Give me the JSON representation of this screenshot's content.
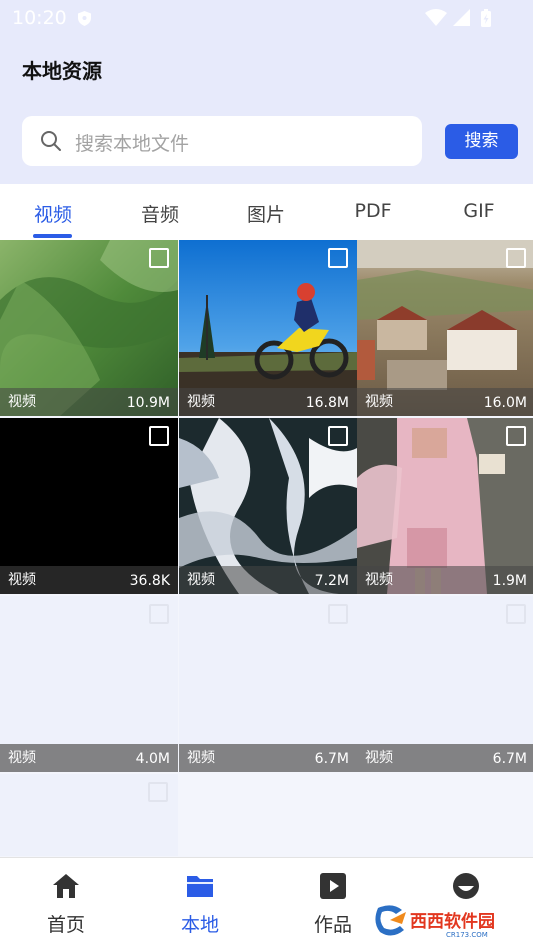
{
  "status_bar": {
    "time": "10:20"
  },
  "header": {
    "title": "本地资源"
  },
  "search": {
    "placeholder": "搜索本地文件",
    "button_label": "搜索"
  },
  "tabs": [
    {
      "label": "视频",
      "active": true
    },
    {
      "label": "音频",
      "active": false
    },
    {
      "label": "图片",
      "active": false
    },
    {
      "label": "PDF",
      "active": false
    },
    {
      "label": "GIF",
      "active": false
    }
  ],
  "media_items": [
    {
      "type_label": "视频",
      "size": "10.9M",
      "thumbnail": "green-mountain-aerial"
    },
    {
      "type_label": "视频",
      "size": "16.8M",
      "thumbnail": "motocross-rider"
    },
    {
      "type_label": "视频",
      "size": "16.0M",
      "thumbnail": "town-aerial"
    },
    {
      "type_label": "视频",
      "size": "36.8K",
      "thumbnail": "black-frame"
    },
    {
      "type_label": "视频",
      "size": "7.2M",
      "thumbnail": "anime-white-hair"
    },
    {
      "type_label": "视频",
      "size": "1.9M",
      "thumbnail": "girl-pink-outfit"
    },
    {
      "type_label": "视频",
      "size": "4.0M",
      "thumbnail": "blank"
    },
    {
      "type_label": "视频",
      "size": "6.7M",
      "thumbnail": "blank"
    },
    {
      "type_label": "视频",
      "size": "6.7M",
      "thumbnail": "blank"
    }
  ],
  "bottom_nav": [
    {
      "label": "首页",
      "icon": "home-icon",
      "active": false
    },
    {
      "label": "本地",
      "icon": "folder-icon",
      "active": true
    },
    {
      "label": "作品",
      "icon": "play-icon",
      "active": false
    },
    {
      "label": "",
      "icon": "profile-icon",
      "active": false
    }
  ],
  "watermark": {
    "text": "西西软件园",
    "subtext": "CR173.COM"
  },
  "colors": {
    "accent": "#2b5ce6",
    "header_bg": "#e7eafb",
    "page_bg": "#f3f5fc"
  }
}
